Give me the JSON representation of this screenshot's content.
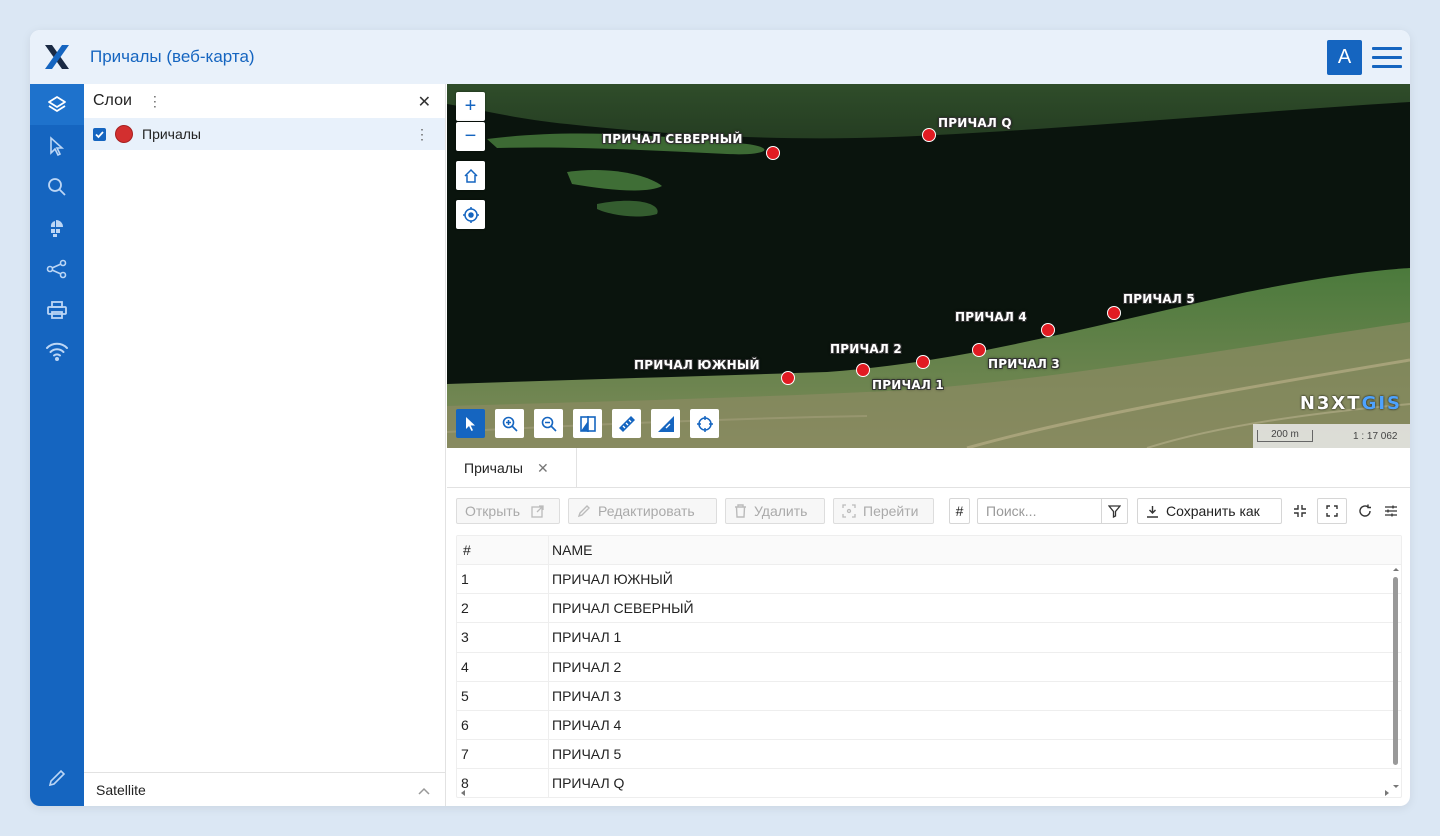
{
  "header": {
    "title": "Причалы (веб-карта)",
    "avatar_letter": "А"
  },
  "rail": {
    "items": [
      "layers-icon",
      "pointer-icon",
      "search-icon",
      "basemap-icon",
      "share-icon",
      "print-icon",
      "wifi-icon"
    ],
    "bottom": "pencil-icon"
  },
  "layers_panel": {
    "title": "Слои",
    "layers": [
      {
        "name": "Причалы",
        "checked": true,
        "color": "#d32f2f"
      }
    ],
    "basemap": "Satellite"
  },
  "map": {
    "controls": {
      "zoom_in": "+",
      "zoom_out": "−"
    },
    "markers": [
      {
        "label": "ПРИЧАЛ СЕВЕРНЫЙ"
      },
      {
        "label": "ПРИЧАЛ Q"
      },
      {
        "label": "ПРИЧАЛ ЮЖНЫЙ"
      },
      {
        "label": "ПРИЧАЛ 2"
      },
      {
        "label": "ПРИЧАЛ 1"
      },
      {
        "label": "ПРИЧАЛ 4"
      },
      {
        "label": "ПРИЧАЛ 3"
      },
      {
        "label": "ПРИЧАЛ 5"
      }
    ],
    "logo_left": "N3XT",
    "logo_right": "GIS",
    "scale": "200 m",
    "ratio": "1 : 17 062"
  },
  "table_tab": {
    "label": "Причалы"
  },
  "toolbar": {
    "open": "Открыть",
    "edit": "Редактировать",
    "delete": "Удалить",
    "goto": "Перейти",
    "hash": "#",
    "search_placeholder": "Поиск...",
    "save_as": "Сохранить как"
  },
  "table": {
    "columns": [
      "#",
      "NAME"
    ],
    "rows": [
      [
        "1",
        "ПРИЧАЛ ЮЖНЫЙ"
      ],
      [
        "2",
        "ПРИЧАЛ СЕВЕРНЫЙ"
      ],
      [
        "3",
        "ПРИЧАЛ 1"
      ],
      [
        "4",
        "ПРИЧАЛ 2"
      ],
      [
        "5",
        "ПРИЧАЛ 3"
      ],
      [
        "6",
        "ПРИЧАЛ 4"
      ],
      [
        "7",
        "ПРИЧАЛ 5"
      ],
      [
        "8",
        "ПРИЧАЛ Q"
      ]
    ]
  }
}
